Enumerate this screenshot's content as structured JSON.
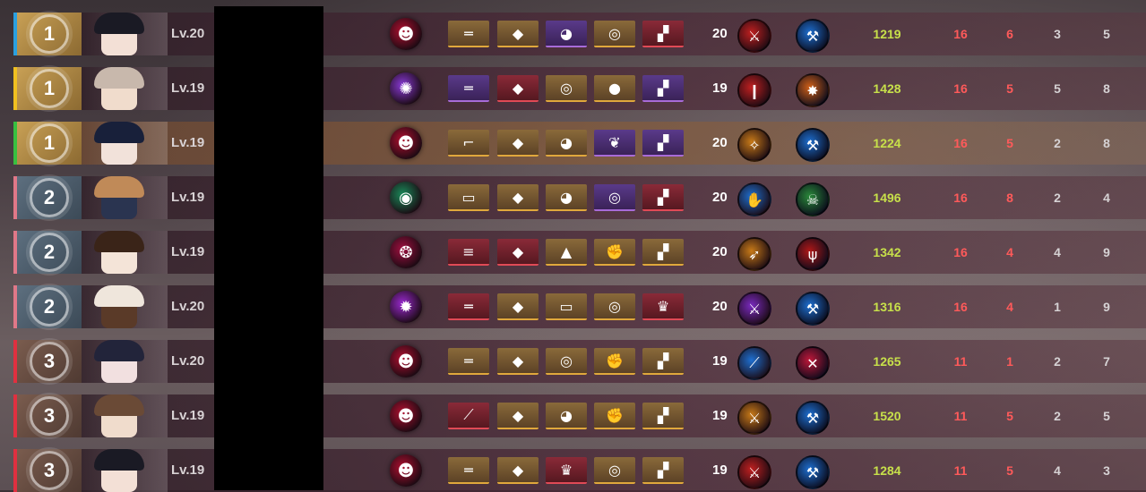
{
  "rows": [
    {
      "rank": "1",
      "tier": "gold",
      "accent": "#2aa0e0",
      "level": "Lv.20",
      "hero": "hero-fanged-mask",
      "hero_color": "#b01030",
      "items": [
        {
          "n": "rifle",
          "t": "gold"
        },
        {
          "n": "armor",
          "t": "gold"
        },
        {
          "n": "helmet",
          "t": "purple"
        },
        {
          "n": "ring",
          "t": "gold"
        },
        {
          "n": "boots",
          "t": "red"
        }
      ],
      "weapon_level": "20",
      "weapon": "red-blade",
      "weapon_color": "#c02020",
      "skill": "blue-axe",
      "skill_color": "#1e6fd0",
      "score": "1219",
      "a": "16",
      "b": "6",
      "c": "3",
      "d": "5",
      "highlight": false,
      "skin": "#f3e0d6",
      "hair": "#1a1a24"
    },
    {
      "rank": "1",
      "tier": "gold",
      "accent": "#f0c020",
      "level": "Lv.19",
      "hero": "hero-purple-vortex",
      "hero_color": "#8a3ad8",
      "items": [
        {
          "n": "rifle",
          "t": "purple"
        },
        {
          "n": "armor",
          "t": "red"
        },
        {
          "n": "ring",
          "t": "gold"
        },
        {
          "n": "disc",
          "t": "gold"
        },
        {
          "n": "boots",
          "t": "purple"
        }
      ],
      "weapon_level": "19",
      "weapon": "red-club",
      "weapon_color": "#c02020",
      "skill": "orange-burst",
      "skill_color": "#d06018",
      "score": "1428",
      "a": "16",
      "b": "5",
      "c": "5",
      "d": "8",
      "highlight": false,
      "skin": "#f0dccc",
      "hair": "#c8b8ac"
    },
    {
      "rank": "1",
      "tier": "gold",
      "accent": "#38c040",
      "level": "Lv.19",
      "hero": "hero-fanged-mask",
      "hero_color": "#b01030",
      "items": [
        {
          "n": "revolver",
          "t": "gold"
        },
        {
          "n": "armor",
          "t": "gold"
        },
        {
          "n": "helmet",
          "t": "gold"
        },
        {
          "n": "feather",
          "t": "purple"
        },
        {
          "n": "boots",
          "t": "purple"
        }
      ],
      "weapon_level": "20",
      "weapon": "orange-pistol",
      "weapon_color": "#c87a18",
      "skill": "blue-axe",
      "skill_color": "#1e6fd0",
      "score": "1224",
      "a": "16",
      "b": "5",
      "c": "2",
      "d": "8",
      "highlight": true,
      "skin": "#f2e2da",
      "hair": "#18203a"
    },
    {
      "rank": "2",
      "tier": "silver",
      "accent": "#e07888",
      "level": "Lv.19",
      "hero": "hero-green-eye",
      "hero_color": "#1a8a5a",
      "items": [
        {
          "n": "visor",
          "t": "gold"
        },
        {
          "n": "armor",
          "t": "gold"
        },
        {
          "n": "helmet",
          "t": "gold"
        },
        {
          "n": "ring",
          "t": "purple"
        },
        {
          "n": "boots",
          "t": "red"
        }
      ],
      "weapon_level": "20",
      "weapon": "blue-glove",
      "weapon_color": "#1e6fd0",
      "skill": "green-skull",
      "skill_color": "#2a8a3a",
      "score": "1496",
      "a": "16",
      "b": "8",
      "c": "2",
      "d": "4",
      "highlight": false,
      "skin": "#2a3450",
      "hair": "#c08a58"
    },
    {
      "rank": "2",
      "tier": "silver",
      "accent": "#e07888",
      "level": "Lv.19",
      "hero": "hero-crimson-swirl",
      "hero_color": "#a01040",
      "items": [
        {
          "n": "blaster",
          "t": "red"
        },
        {
          "n": "armor",
          "t": "red"
        },
        {
          "n": "hat",
          "t": "gold"
        },
        {
          "n": "gauntlet",
          "t": "gold"
        },
        {
          "n": "boots",
          "t": "gold"
        }
      ],
      "weapon_level": "20",
      "weapon": "orange-rifle",
      "weapon_color": "#c87a18",
      "skill": "red-trident",
      "skill_color": "#b01818",
      "score": "1342",
      "a": "16",
      "b": "4",
      "c": "4",
      "d": "9",
      "highlight": false,
      "skin": "#f4e4d8",
      "hair": "#3a2418"
    },
    {
      "rank": "2",
      "tier": "silver",
      "accent": "#e07888",
      "level": "Lv.20",
      "hero": "hero-purple-flare",
      "hero_color": "#9a2ad0",
      "items": [
        {
          "n": "rifle",
          "t": "red"
        },
        {
          "n": "armor",
          "t": "gold"
        },
        {
          "n": "visor",
          "t": "gold"
        },
        {
          "n": "ring",
          "t": "gold"
        },
        {
          "n": "crown",
          "t": "red"
        }
      ],
      "weapon_level": "20",
      "weapon": "purple-sword",
      "weapon_color": "#7a2ac0",
      "skill": "blue-axe",
      "skill_color": "#1e6fd0",
      "score": "1316",
      "a": "16",
      "b": "4",
      "c": "1",
      "d": "9",
      "highlight": false,
      "skin": "#5a3a28",
      "hair": "#efe6dc"
    },
    {
      "rank": "3",
      "tier": "bronze",
      "accent": "#e03040",
      "level": "Lv.20",
      "hero": "hero-fanged-mask",
      "hero_color": "#b01030",
      "items": [
        {
          "n": "rifle",
          "t": "gold"
        },
        {
          "n": "armor",
          "t": "gold"
        },
        {
          "n": "ring",
          "t": "gold"
        },
        {
          "n": "gauntlet",
          "t": "gold"
        },
        {
          "n": "boots",
          "t": "gold"
        }
      ],
      "weapon_level": "19",
      "weapon": "blue-blade",
      "weapon_color": "#1e6fd0",
      "skill": "red-slash",
      "skill_color": "#c0183a",
      "score": "1265",
      "a": "11",
      "b": "1",
      "c": "2",
      "d": "7",
      "highlight": false,
      "skin": "#f2e0e0",
      "hair": "#22243a"
    },
    {
      "rank": "3",
      "tier": "bronze",
      "accent": "#e03040",
      "level": "Lv.19",
      "hero": "hero-fanged-mask",
      "hero_color": "#b01030",
      "items": [
        {
          "n": "dagger",
          "t": "red"
        },
        {
          "n": "armor",
          "t": "gold"
        },
        {
          "n": "helmet",
          "t": "gold"
        },
        {
          "n": "gauntlet",
          "t": "gold"
        },
        {
          "n": "boots",
          "t": "gold"
        }
      ],
      "weapon_level": "19",
      "weapon": "orange-blade",
      "weapon_color": "#c87a18",
      "skill": "blue-axe",
      "skill_color": "#1e6fd0",
      "score": "1520",
      "a": "11",
      "b": "5",
      "c": "2",
      "d": "5",
      "highlight": false,
      "skin": "#f0dccc",
      "hair": "#6a4a36"
    },
    {
      "rank": "3",
      "tier": "bronze",
      "accent": "#e03040",
      "level": "Lv.19",
      "hero": "hero-fanged-mask",
      "hero_color": "#b01030",
      "items": [
        {
          "n": "rifle",
          "t": "gold"
        },
        {
          "n": "armor",
          "t": "gold"
        },
        {
          "n": "crown",
          "t": "red"
        },
        {
          "n": "ring",
          "t": "gold"
        },
        {
          "n": "boots",
          "t": "gold"
        }
      ],
      "weapon_level": "19",
      "weapon": "red-blade",
      "weapon_color": "#c02020",
      "skill": "blue-axe",
      "skill_color": "#1e6fd0",
      "score": "1284",
      "a": "11",
      "b": "5",
      "c": "4",
      "d": "3",
      "highlight": false,
      "skin": "#f3e0d6",
      "hair": "#1a1a24"
    }
  ]
}
